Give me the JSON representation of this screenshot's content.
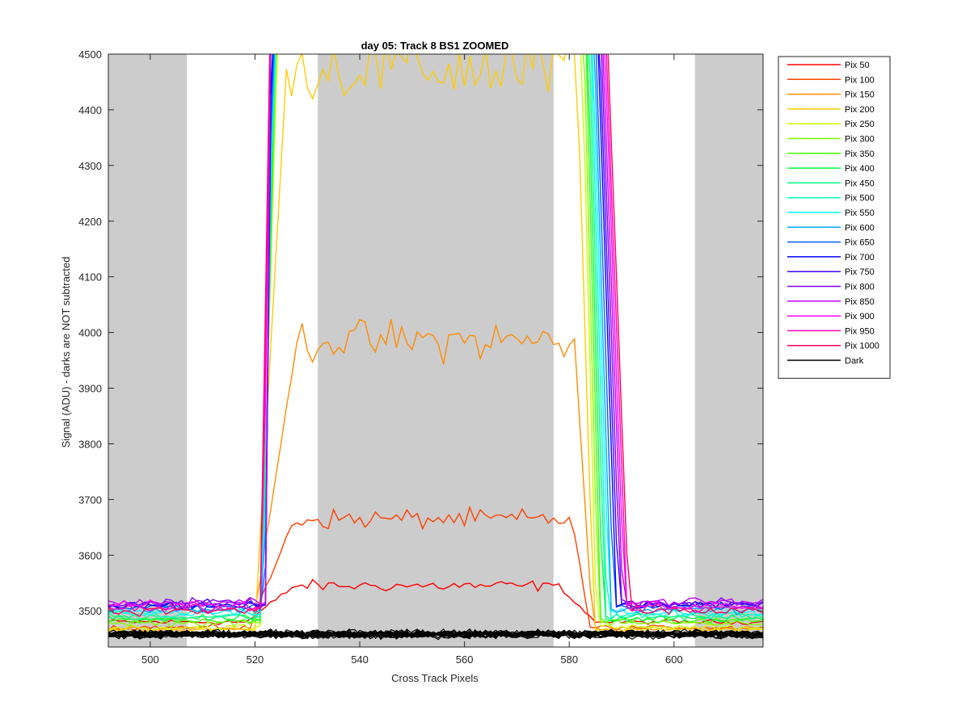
{
  "chart_data": {
    "type": "line",
    "title": "day 05: Track 8  BS1 ZOOMED",
    "xlabel": "Cross Track Pixels",
    "ylabel": "Signal (ADU) - darks are NOT subtracted",
    "xlim": [
      492,
      617
    ],
    "ylim": [
      3435,
      4500
    ],
    "xticks": [
      500,
      520,
      540,
      560,
      580,
      600
    ],
    "yticks": [
      3500,
      3600,
      3700,
      3800,
      3900,
      4000,
      4100,
      4200,
      4300,
      4400,
      4500
    ],
    "grid": false,
    "legend_position": "outside-right",
    "shaded_regions": [
      [
        492,
        507
      ],
      [
        532,
        577
      ],
      [
        604,
        617
      ]
    ],
    "shade_color": "#cccccc",
    "series": [
      {
        "name": "Pix 50",
        "color": "#ff0000",
        "base": 3480,
        "plateau": 3545,
        "rise": [
          518.5,
          527.5
        ],
        "fall": [
          578,
          585
        ],
        "left_noise": 5,
        "right_noise": 4
      },
      {
        "name": "Pix 100",
        "color": "#ff4000",
        "base": 3470,
        "plateau": 3665,
        "rise": [
          519,
          527.5
        ],
        "fall": [
          580.5,
          584
        ],
        "left_noise": 5,
        "right_noise": 4
      },
      {
        "name": "Pix 150",
        "color": "#ff8c00",
        "base": 3468,
        "plateau": 3985,
        "rise": [
          519.5,
          528
        ],
        "fall": [
          581,
          584.5
        ],
        "left_noise": 5,
        "right_noise": 4
      },
      {
        "name": "Pix 200",
        "color": "#ffcc00",
        "base": 3466,
        "plateau": 4475,
        "rise": [
          520,
          526
        ],
        "fall": [
          581.5,
          584.7
        ],
        "left_noise": 5,
        "right_noise": 4
      },
      {
        "name": "Pix 250",
        "color": "#ccff00",
        "base": 3470,
        "plateau": 4600,
        "rise": [
          521,
          524.5
        ],
        "fall": [
          582.2,
          585.2
        ],
        "left_noise": 6,
        "right_noise": 5
      },
      {
        "name": "Pix 300",
        "color": "#80ff00",
        "base": 3478,
        "plateau": 4600,
        "rise": [
          521.2,
          524.3
        ],
        "fall": [
          582.6,
          585.6
        ],
        "left_noise": 6,
        "right_noise": 5
      },
      {
        "name": "Pix 350",
        "color": "#40ff00",
        "base": 3482,
        "plateau": 4600,
        "rise": [
          521.3,
          524.1
        ],
        "fall": [
          583,
          586
        ],
        "left_noise": 6,
        "right_noise": 6
      },
      {
        "name": "Pix 400",
        "color": "#00ff40",
        "base": 3486,
        "plateau": 4600,
        "rise": [
          521.4,
          523.9
        ],
        "fall": [
          583.3,
          586.4
        ],
        "left_noise": 6,
        "right_noise": 6
      },
      {
        "name": "Pix 450",
        "color": "#00ff80",
        "base": 3490,
        "plateau": 4600,
        "rise": [
          521.5,
          523.8
        ],
        "fall": [
          583.6,
          586.8
        ],
        "left_noise": 6,
        "right_noise": 6
      },
      {
        "name": "Pix 500",
        "color": "#00ffc0",
        "base": 3494,
        "plateau": 4600,
        "rise": [
          521.6,
          523.6
        ],
        "fall": [
          583.9,
          587.2
        ],
        "left_noise": 7,
        "right_noise": 7
      },
      {
        "name": "Pix 550",
        "color": "#00ffff",
        "base": 3498,
        "plateau": 4600,
        "rise": [
          521.7,
          523.5
        ],
        "fall": [
          584.2,
          587.6
        ],
        "left_noise": 7,
        "right_noise": 7
      },
      {
        "name": "Pix 600",
        "color": "#00a8ff",
        "base": 3502,
        "plateau": 4600,
        "rise": [
          521.8,
          523.4
        ],
        "fall": [
          584.5,
          588
        ],
        "left_noise": 7,
        "right_noise": 7
      },
      {
        "name": "Pix 650",
        "color": "#0060ff",
        "base": 3506,
        "plateau": 4600,
        "rise": [
          521.9,
          523.3
        ],
        "fall": [
          584.8,
          588.5
        ],
        "left_noise": 7,
        "right_noise": 7
      },
      {
        "name": "Pix 700",
        "color": "#0000ff",
        "base": 3510,
        "plateau": 4600,
        "rise": [
          522,
          523.2
        ],
        "fall": [
          585.2,
          589
        ],
        "left_noise": 8,
        "right_noise": 7
      },
      {
        "name": "Pix 750",
        "color": "#4000ff",
        "base": 3512,
        "plateau": 4600,
        "rise": [
          522,
          523.1
        ],
        "fall": [
          585.5,
          589.4
        ],
        "left_noise": 8,
        "right_noise": 7
      },
      {
        "name": "Pix 800",
        "color": "#8000ff",
        "base": 3514,
        "plateau": 4600,
        "rise": [
          522,
          523.1
        ],
        "fall": [
          585.8,
          589.8
        ],
        "left_noise": 8,
        "right_noise": 8
      },
      {
        "name": "Pix 850",
        "color": "#c000ff",
        "base": 3516,
        "plateau": 4600,
        "rise": [
          522,
          523
        ],
        "fall": [
          586.1,
          590.2
        ],
        "left_noise": 8,
        "right_noise": 8
      },
      {
        "name": "Pix 900",
        "color": "#ff00ff",
        "base": 3510,
        "plateau": 4600,
        "rise": [
          521.5,
          523
        ],
        "fall": [
          586.4,
          590.6
        ],
        "left_noise": 8,
        "right_noise": 8
      },
      {
        "name": "Pix 950",
        "color": "#ff00c0",
        "base": 3506,
        "plateau": 4600,
        "rise": [
          521.3,
          523
        ],
        "fall": [
          586.7,
          591
        ],
        "left_noise": 8,
        "right_noise": 8
      },
      {
        "name": "Pix 1000",
        "color": "#ff0060",
        "base": 3500,
        "plateau": 4600,
        "rise": [
          521,
          523
        ],
        "fall": [
          587,
          591.4
        ],
        "left_noise": 8,
        "right_noise": 8
      },
      {
        "name": "Dark",
        "color": "#000000",
        "base": 3458,
        "plateau": 3458,
        "rise": [
          0,
          0
        ],
        "fall": [
          0,
          0
        ],
        "left_noise": 7,
        "right_noise": 7
      }
    ],
    "dark_repeats": 20
  }
}
